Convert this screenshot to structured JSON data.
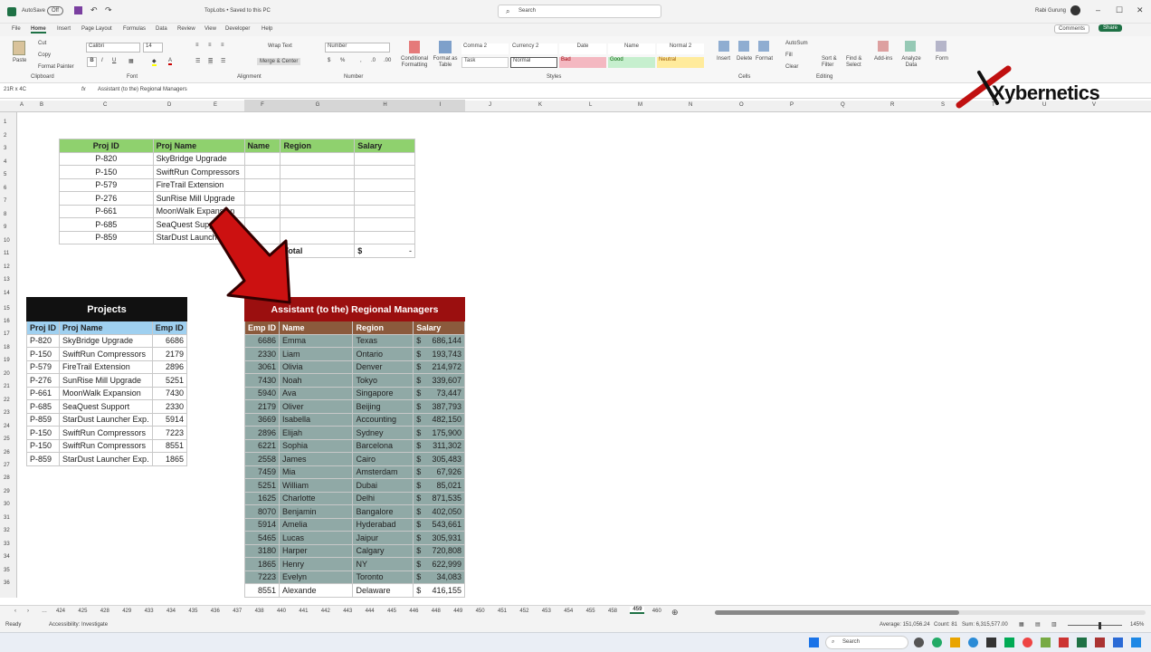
{
  "titlebar": {
    "autosave": "AutoSave",
    "autosave_state": "Off",
    "file": "TopLobs • Saved to this PC",
    "search": "Search",
    "user": "Rabi Gurung"
  },
  "menu": [
    "File",
    "Home",
    "Insert",
    "Page Layout",
    "Formulas",
    "Data",
    "Review",
    "View",
    "Developer",
    "Help"
  ],
  "ribbon": {
    "paste": "Paste",
    "cut": "Cut",
    "copy": "Copy",
    "format_painter": "Format Painter",
    "clipboard": "Clipboard",
    "font_name": "Calibri",
    "font_size": "14",
    "font_group": "Font",
    "wrap": "Wrap Text",
    "merge": "Merge & Center",
    "alignment": "Alignment",
    "num_format": "Number",
    "number_group": "Number",
    "cond_fmt": "Conditional Formatting",
    "format_table": "Format as Table",
    "styles": [
      "Comma 2",
      "Currency 2",
      "Date",
      "Name",
      "Normal 2",
      "Task",
      "Normal",
      "Bad",
      "Good",
      "Neutral"
    ],
    "styles_group": "Styles",
    "insert": "Insert",
    "delete": "Delete",
    "format": "Format",
    "cells_group": "Cells",
    "autosum": "AutoSum",
    "fill": "Fill",
    "clear": "Clear",
    "sort": "Sort & Filter",
    "find": "Find & Select",
    "editing_group": "Editing",
    "addins": "Add-ins",
    "analyze": "Analyze Data",
    "form": "Form",
    "comments": "Comments",
    "share": "Share"
  },
  "formula": {
    "namebox": "21R x 4C",
    "fx": "fx",
    "content": "Assistant (to the) Regional Managers"
  },
  "logo": "Xybernetics",
  "columns": [
    "A",
    "B",
    "C",
    "D",
    "E",
    "F",
    "G",
    "H",
    "I",
    "J",
    "K",
    "L",
    "M",
    "N",
    "O",
    "P",
    "Q",
    "R",
    "S",
    "T",
    "U",
    "V"
  ],
  "rows": [
    "1",
    "2",
    "3",
    "4",
    "5",
    "6",
    "7",
    "8",
    "9",
    "10",
    "11",
    "12",
    "13",
    "14",
    "15",
    "16",
    "17",
    "18",
    "19",
    "20",
    "21",
    "22",
    "23",
    "24",
    "25",
    "26",
    "27",
    "28",
    "29",
    "30",
    "31",
    "32",
    "33",
    "34",
    "35",
    "36"
  ],
  "lookup": {
    "headers": [
      "Proj ID",
      "Proj Name",
      "Name",
      "Region",
      "Salary"
    ],
    "rows": [
      [
        "P-820",
        "SkyBridge Upgrade"
      ],
      [
        "P-150",
        "SwiftRun Compressors"
      ],
      [
        "P-579",
        "FireTrail Extension"
      ],
      [
        "P-276",
        "SunRise Mill Upgrade"
      ],
      [
        "P-661",
        "MoonWalk Expansion"
      ],
      [
        "P-685",
        "SeaQuest Support"
      ],
      [
        "P-859",
        "StarDust Launcher"
      ]
    ],
    "total_label": "Total",
    "total_currency": "$",
    "total_value": "-"
  },
  "projects": {
    "title": "Projects",
    "headers": [
      "Proj ID",
      "Proj Name",
      "Emp ID"
    ],
    "rows": [
      [
        "P-820",
        "SkyBridge Upgrade",
        "6686"
      ],
      [
        "P-150",
        "SwiftRun Compressors",
        "2179"
      ],
      [
        "P-579",
        "FireTrail Extension",
        "2896"
      ],
      [
        "P-276",
        "SunRise Mill Upgrade",
        "5251"
      ],
      [
        "P-661",
        "MoonWalk Expansion",
        "7430"
      ],
      [
        "P-685",
        "SeaQuest Support",
        "2330"
      ],
      [
        "P-859",
        "StarDust Launcher Exp.",
        "5914"
      ],
      [
        "P-150",
        "SwiftRun Compressors",
        "7223"
      ],
      [
        "P-150",
        "SwiftRun Compressors",
        "8551"
      ],
      [
        "P-859",
        "StarDust Launcher Exp.",
        "1865"
      ]
    ]
  },
  "managers": {
    "title": "Assistant (to the) Regional Managers",
    "headers": [
      "Emp ID",
      "Name",
      "Region",
      "Salary"
    ],
    "rows": [
      [
        "6686",
        "Emma",
        "Texas",
        "686,144"
      ],
      [
        "2330",
        "Liam",
        "Ontario",
        "193,743"
      ],
      [
        "3061",
        "Olivia",
        "Denver",
        "214,972"
      ],
      [
        "7430",
        "Noah",
        "Tokyo",
        "339,607"
      ],
      [
        "5940",
        "Ava",
        "Singapore",
        "73,447"
      ],
      [
        "2179",
        "Oliver",
        "Beijing",
        "387,793"
      ],
      [
        "3669",
        "Isabella",
        "Accounting",
        "482,150"
      ],
      [
        "2896",
        "Elijah",
        "Sydney",
        "175,900"
      ],
      [
        "6221",
        "Sophia",
        "Barcelona",
        "311,302"
      ],
      [
        "2558",
        "James",
        "Cairo",
        "305,483"
      ],
      [
        "7459",
        "Mia",
        "Amsterdam",
        "67,926"
      ],
      [
        "5251",
        "William",
        "Dubai",
        "85,021"
      ],
      [
        "1625",
        "Charlotte",
        "Delhi",
        "871,535"
      ],
      [
        "8070",
        "Benjamin",
        "Bangalore",
        "402,050"
      ],
      [
        "5914",
        "Amelia",
        "Hyderabad",
        "543,661"
      ],
      [
        "5465",
        "Lucas",
        "Jaipur",
        "305,931"
      ],
      [
        "3180",
        "Harper",
        "Calgary",
        "720,808"
      ],
      [
        "1865",
        "Henry",
        "NY",
        "622,999"
      ],
      [
        "7223",
        "Evelyn",
        "Toronto",
        "34,083"
      ],
      [
        "8551",
        "Alexande",
        "Delaware",
        "416,155"
      ]
    ],
    "currency": "$"
  },
  "sheet_tabs": [
    "424",
    "425",
    "428",
    "429",
    "433",
    "434",
    "435",
    "436",
    "437",
    "438",
    "440",
    "441",
    "442",
    "443",
    "444",
    "445",
    "446",
    "448",
    "449",
    "450",
    "451",
    "452",
    "453",
    "454",
    "455",
    "458",
    "459",
    "460"
  ],
  "active_tab": "459",
  "status": {
    "ready": "Ready",
    "accessibility": "Accessibility: Investigate",
    "average": "Average: 151,056.24",
    "count": "Count: 81",
    "sum": "Sum: 6,315,577.00",
    "zoom": "145%"
  },
  "taskbar": {
    "search": "Search"
  },
  "colors": {
    "green": "#8fd16e",
    "dark": "#111111",
    "red": "#9b0f0f",
    "brown": "#8b5a3c",
    "teal": "#90a9a6",
    "blue_hdr": "#9fd0f0"
  }
}
